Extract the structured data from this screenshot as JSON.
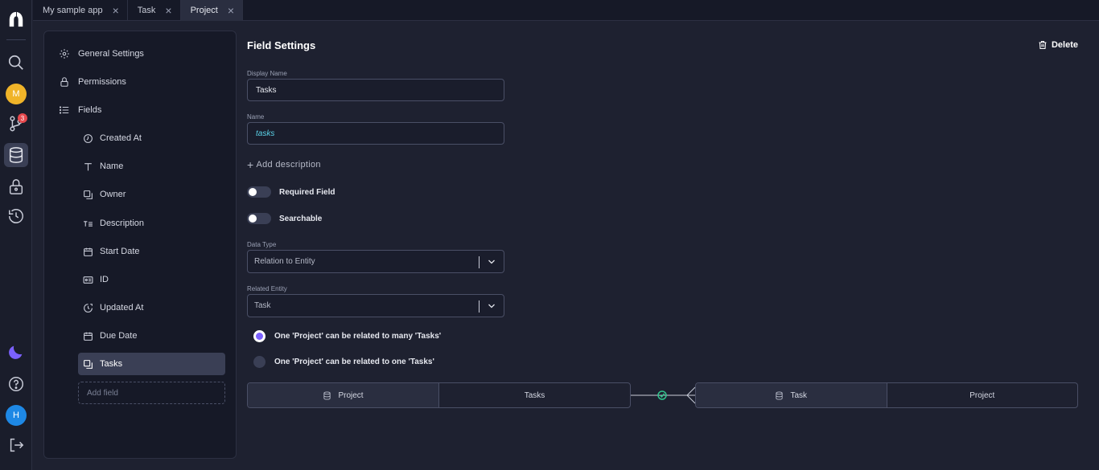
{
  "tabs": [
    {
      "label": "My sample app"
    },
    {
      "label": "Task"
    },
    {
      "label": "Project"
    }
  ],
  "rail": {
    "user_initial": "M",
    "notification_count": "3",
    "bottom_user_initial": "H",
    "colors": {
      "user": "#f0b429",
      "bottom_user": "#1e88e5",
      "theme": "#7b61ff"
    }
  },
  "sidebar": {
    "nav": [
      {
        "label": "General Settings",
        "icon": "gear-icon"
      },
      {
        "label": "Permissions",
        "icon": "lock-icon"
      },
      {
        "label": "Fields",
        "icon": "list-icon"
      }
    ],
    "fields": [
      {
        "label": "Created At",
        "icon": "clock-icon"
      },
      {
        "label": "Name",
        "icon": "text-icon"
      },
      {
        "label": "Owner",
        "icon": "relation-icon"
      },
      {
        "label": "Description",
        "icon": "multiline-text-icon"
      },
      {
        "label": "Start Date",
        "icon": "calendar-icon"
      },
      {
        "label": "ID",
        "icon": "id-card-icon"
      },
      {
        "label": "Updated At",
        "icon": "clock-refresh-icon"
      },
      {
        "label": "Due Date",
        "icon": "calendar-icon"
      },
      {
        "label": "Tasks",
        "icon": "relation-icon"
      }
    ],
    "add_field_placeholder": "Add field"
  },
  "main": {
    "title": "Field Settings",
    "delete_label": "Delete",
    "display_name": {
      "label": "Display Name",
      "value": "Tasks"
    },
    "name": {
      "label": "Name",
      "value": "tasks"
    },
    "add_description": "Add description",
    "required_field": {
      "label": "Required Field",
      "on": false
    },
    "searchable": {
      "label": "Searchable",
      "on": false
    },
    "data_type": {
      "label": "Data Type",
      "value": "Relation to Entity"
    },
    "related_entity": {
      "label": "Related Entity",
      "value": "Task"
    },
    "relation_options": [
      {
        "label": "One 'Project' can be related to many 'Tasks'",
        "selected": true
      },
      {
        "label": "One 'Project' can be related to one 'Tasks'",
        "selected": false
      }
    ],
    "relation_diagram": {
      "left_entity": "Project",
      "left_field": "Tasks",
      "right_entity": "Task",
      "right_field": "Project"
    }
  }
}
